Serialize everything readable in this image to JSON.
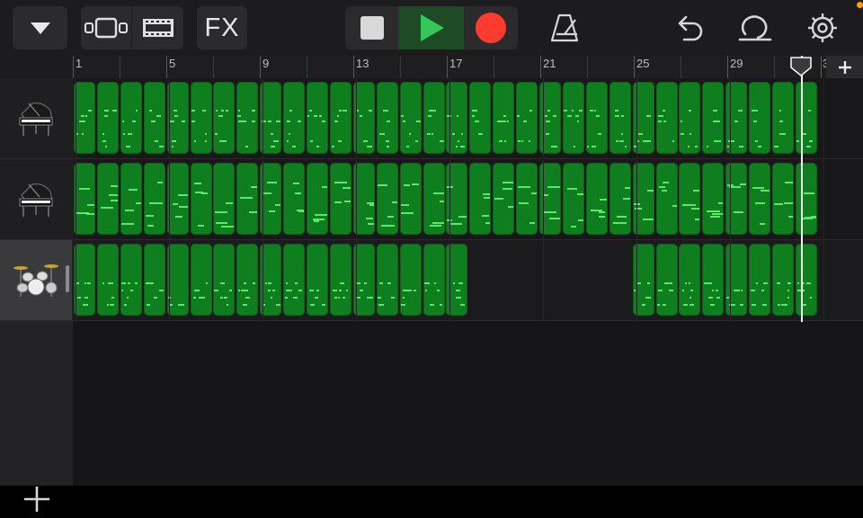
{
  "toolbar": {
    "fx_label": "FX",
    "icons": {
      "browser": "triangle-down-icon",
      "tracks_view": "tracks-view-icon",
      "mixer": "film-strip-icon",
      "stop": "stop-icon",
      "play": "play-icon",
      "record": "record-icon",
      "metronome": "metronome-icon",
      "undo": "undo-icon",
      "loop": "loop-icon",
      "settings": "gear-icon"
    },
    "colors": {
      "play": "#34c759",
      "record": "#ff3b30",
      "region": "#0f7e1e",
      "note": "#59e86a"
    }
  },
  "ruler": {
    "bar_labels": [
      "1",
      "5",
      "9",
      "13",
      "17",
      "21",
      "25",
      "29",
      "3"
    ],
    "add_section_label": "+"
  },
  "tracks": [
    {
      "name": "Grand Piano",
      "icon": "grand-piano-icon",
      "selected": false
    },
    {
      "name": "Grand Piano",
      "icon": "grand-piano-icon",
      "selected": false
    },
    {
      "name": "Drum Kit",
      "icon": "drum-kit-icon",
      "selected": true
    }
  ],
  "add_track_label": "+"
}
